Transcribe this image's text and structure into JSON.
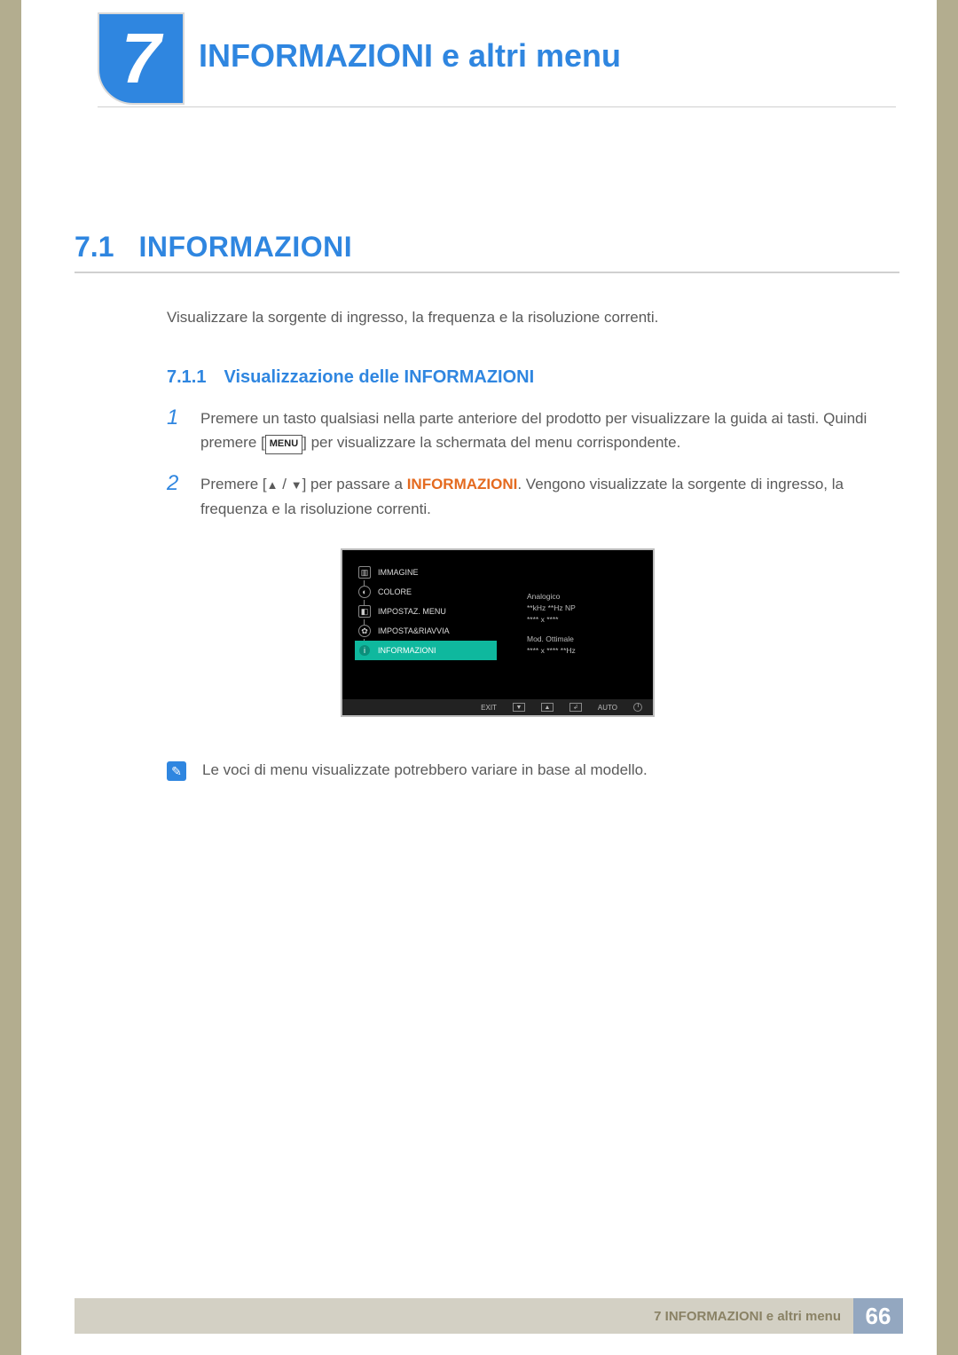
{
  "chapter": {
    "number": "7",
    "title": "INFORMAZIONI e altri menu"
  },
  "section": {
    "number": "7.1",
    "title": "INFORMAZIONI",
    "description": "Visualizzare la sorgente di ingresso, la frequenza e la risoluzione correnti."
  },
  "subsection": {
    "number": "7.1.1",
    "title": "Visualizzazione delle INFORMAZIONI"
  },
  "steps": [
    {
      "num": "1",
      "pre": "Premere un tasto qualsiasi nella parte anteriore del prodotto per visualizzare la guida ai tasti. Quindi premere [",
      "menu": "MENU",
      "post": "] per visualizzare la schermata del menu corrispondente."
    },
    {
      "num": "2",
      "pre": "Premere [",
      "mid": "] per passare a ",
      "highlight": "INFORMAZIONI",
      "post": ". Vengono visualizzate la sorgente di ingresso, la frequenza e la risoluzione correnti."
    }
  ],
  "osd": {
    "menu_items": [
      "IMMAGINE",
      "COLORE",
      "IMPOSTAZ. MENU",
      "IMPOSTA&RIAVVIA",
      "INFORMAZIONI"
    ],
    "info": {
      "line1": "Analogico",
      "line2": "**kHz **Hz NP",
      "line3": "**** x ****",
      "line4": "Mod. Ottimale",
      "line5": "**** x ****  **Hz"
    },
    "footer": {
      "exit": "EXIT",
      "auto": "AUTO"
    }
  },
  "note": "Le voci di menu visualizzate potrebbero variare in base al modello.",
  "footer": {
    "text": "7 INFORMAZIONI e altri menu",
    "page": "66"
  }
}
